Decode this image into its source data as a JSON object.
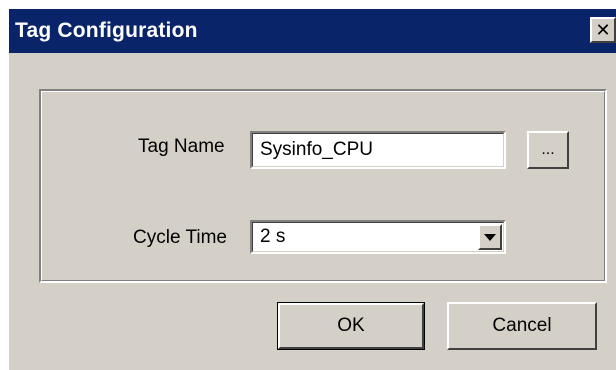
{
  "dialog": {
    "title": "Tag Configuration",
    "close_glyph": "✕"
  },
  "form": {
    "tag_name_label": "Tag Name",
    "tag_name_value": "Sysinfo_CPU",
    "browse_label": "...",
    "cycle_time_label": "Cycle Time",
    "cycle_time_value": "2 s"
  },
  "buttons": {
    "ok_label": "OK",
    "cancel_label": "Cancel"
  },
  "colors": {
    "titlebar": "#0a246a",
    "face": "#d4d0c8"
  }
}
